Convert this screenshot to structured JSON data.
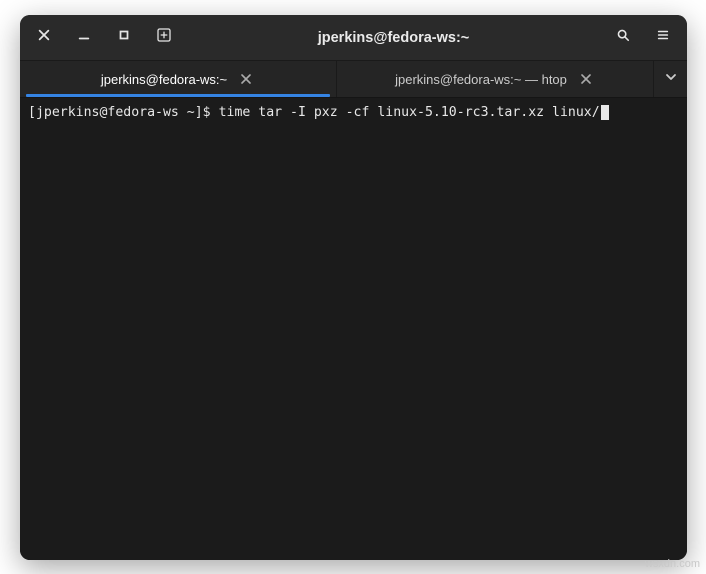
{
  "titlebar": {
    "title": "jperkins@fedora-ws:~"
  },
  "tabs": [
    {
      "label": "jperkins@fedora-ws:~",
      "active": true
    },
    {
      "label": "jperkins@fedora-ws:~ — htop",
      "active": false
    }
  ],
  "terminal": {
    "prompt": "[jperkins@fedora-ws ~]$ ",
    "command": "time tar -I pxz -cf linux-5.10-rc3.tar.xz linux/"
  },
  "watermark": "wsxdn.com"
}
